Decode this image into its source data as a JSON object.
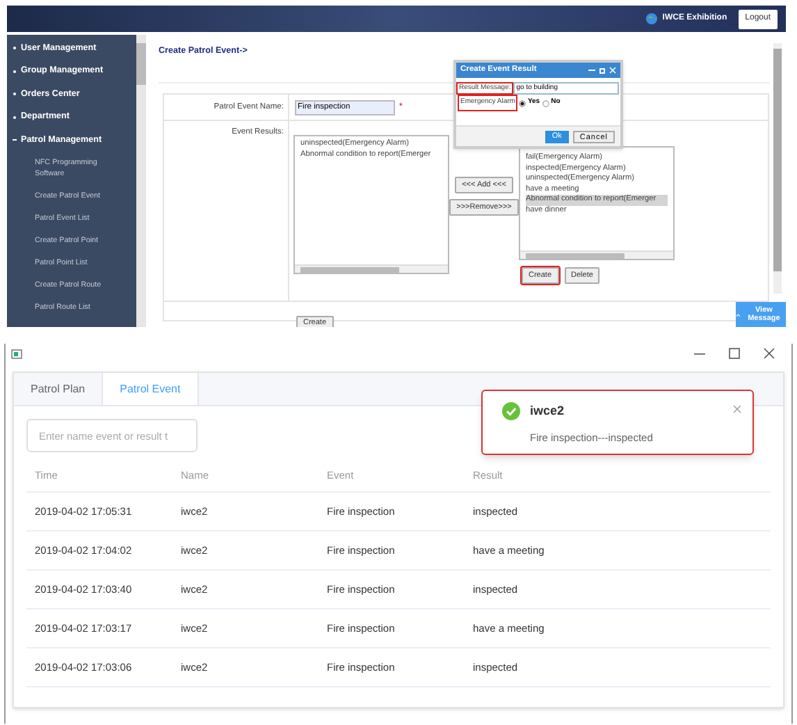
{
  "admin": {
    "header": {
      "site": "IWCE Exhibition",
      "logout": "Logout"
    },
    "sidebar": {
      "items": [
        {
          "label": "User Management",
          "expanded": false
        },
        {
          "label": "Group Management",
          "expanded": false
        },
        {
          "label": "Orders Center",
          "expanded": false
        },
        {
          "label": "Department",
          "expanded": false
        },
        {
          "label": "Patrol Management",
          "expanded": true,
          "children": [
            {
              "label": "NFC Programming Software"
            },
            {
              "label": "Create Patrol Event"
            },
            {
              "label": "Patrol Event List"
            },
            {
              "label": "Create Patrol Point"
            },
            {
              "label": "Patrol Point List"
            },
            {
              "label": "Create Patrol Route"
            },
            {
              "label": "Patrol Route List"
            }
          ]
        }
      ]
    },
    "form": {
      "title": "Create Patrol Event->",
      "name_label": "Patrol Event Name:",
      "name_value": "Fire inspection",
      "required_mark": "*",
      "results_label": "Event Results:",
      "left_list": [
        {
          "label": "uninspected(Emergency Alarm)",
          "selected": false
        },
        {
          "label": "Abnormal condition to report(Emerger",
          "selected": false
        }
      ],
      "add_button": "<<< Add <<<",
      "remove_button": ">>>Remove>>>",
      "right_list": [
        {
          "label": "fail(Emergency Alarm)",
          "selected": false
        },
        {
          "label": "inspected(Emergency Alarm)",
          "selected": false
        },
        {
          "label": "uninspected(Emergency Alarm)",
          "selected": false
        },
        {
          "label": "have a meeting",
          "selected": false
        },
        {
          "label": "Abnormal condition to report(Emerger",
          "selected": true
        },
        {
          "label": "have dinner",
          "selected": false
        }
      ],
      "create_button": {
        "label": "Create",
        "highlighted": true
      },
      "delete_button": "Delete",
      "submit_button": "Create"
    },
    "dialog": {
      "title": "Create Event Result",
      "message_label": {
        "label": "Result Message:",
        "highlighted": true
      },
      "message_value": "go to building",
      "alarm_label": {
        "label": "Emergency Alarm",
        "highlighted": true
      },
      "alarm_options": [
        {
          "label": "Yes",
          "selected": true
        },
        {
          "label": "No",
          "selected": false
        }
      ],
      "ok": "Ok",
      "cancel": "Cancel"
    },
    "view_message": "View Message"
  },
  "client": {
    "tabs": [
      {
        "label": "Patrol Plan",
        "selected": false
      },
      {
        "label": "Patrol Event",
        "selected": true
      }
    ],
    "search": {
      "placeholder": "Enter name event or result t"
    },
    "table": {
      "columns": [
        "Time",
        "Name",
        "Event",
        "Result"
      ],
      "rows": [
        [
          "2019-04-02 17:05:31",
          "iwce2",
          "Fire inspection",
          "inspected"
        ],
        [
          "2019-04-02 17:04:02",
          "iwce2",
          "Fire inspection",
          "have a meeting"
        ],
        [
          "2019-04-02 17:03:40",
          "iwce2",
          "Fire inspection",
          "inspected"
        ],
        [
          "2019-04-02 17:03:17",
          "iwce2",
          "Fire inspection",
          "have a meeting"
        ],
        [
          "2019-04-02 17:03:06",
          "iwce2",
          "Fire inspection",
          "inspected"
        ]
      ]
    },
    "notification": {
      "title": "iwce2",
      "message": "Fire inspection---inspected",
      "highlighted": true
    }
  }
}
